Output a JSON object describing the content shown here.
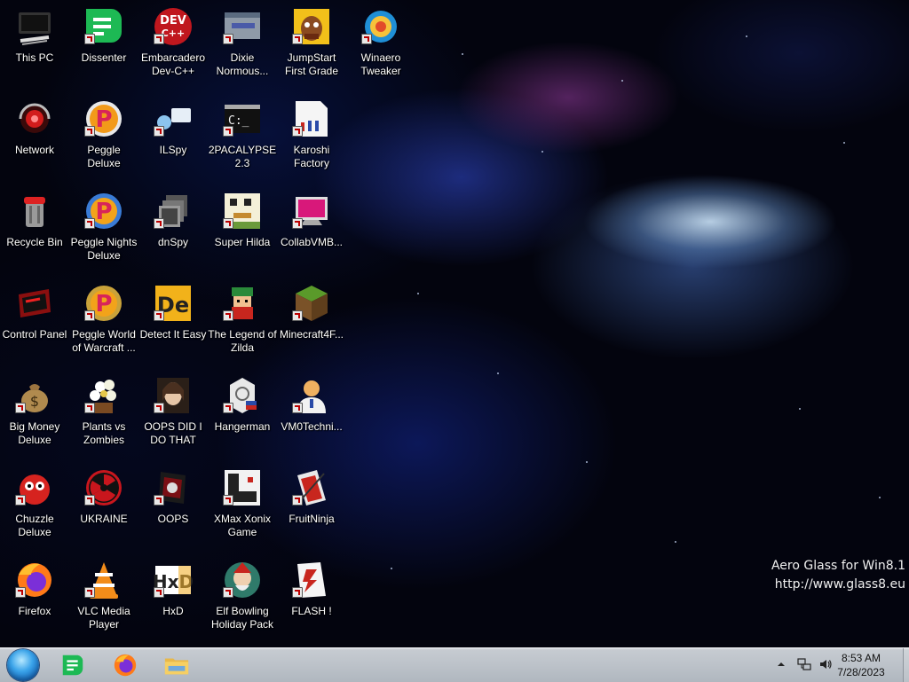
{
  "desktop": {
    "watermark": {
      "line1": "Aero Glass for Win8.1",
      "line2": "http://www.glass8.eu"
    },
    "icons": [
      {
        "label": "This PC",
        "icon": "computer-icon"
      },
      {
        "label": "Network",
        "icon": "network-icon"
      },
      {
        "label": "Recycle Bin",
        "icon": "recycle-bin-icon"
      },
      {
        "label": "Control Panel",
        "icon": "control-panel-icon"
      },
      {
        "label": "Big Money Deluxe",
        "icon": "money-bag-icon"
      },
      {
        "label": "Chuzzle Deluxe",
        "icon": "chuzzle-icon"
      },
      {
        "label": "Firefox",
        "icon": "firefox-icon"
      },
      {
        "label": "Dissenter",
        "icon": "dissenter-icon"
      },
      {
        "label": "Peggle Deluxe",
        "icon": "peggle-icon"
      },
      {
        "label": "Peggle Nights Deluxe",
        "icon": "peggle-nights-icon"
      },
      {
        "label": "Peggle World of Warcraft ...",
        "icon": "peggle-wow-icon"
      },
      {
        "label": "Plants vs Zombies",
        "icon": "plants-vs-zombies-icon"
      },
      {
        "label": "UKRAINE",
        "icon": "radiation-icon"
      },
      {
        "label": "VLC Media Player",
        "icon": "vlc-icon"
      },
      {
        "label": "Embarcadero Dev-C++",
        "icon": "devcpp-icon"
      },
      {
        "label": "ILSpy",
        "icon": "ilspy-icon"
      },
      {
        "label": "dnSpy",
        "icon": "dnspy-icon"
      },
      {
        "label": "Detect It Easy",
        "icon": "detect-it-easy-icon"
      },
      {
        "label": "OOPS DID I DO THAT",
        "icon": "portrait-icon"
      },
      {
        "label": "OOPS",
        "icon": "oops-icon"
      },
      {
        "label": "HxD",
        "icon": "hxd-icon"
      },
      {
        "label": "Dixie Normous...",
        "icon": "window-app-icon"
      },
      {
        "label": "2PACALYPSE 2.3",
        "icon": "console-icon"
      },
      {
        "label": "Super Hilda",
        "icon": "pixel-game-icon"
      },
      {
        "label": "The Legend of Zilda",
        "icon": "zilda-icon"
      },
      {
        "label": "Hangerman",
        "icon": "hangerman-icon"
      },
      {
        "label": "XMax Xonix Game",
        "icon": "xonix-icon"
      },
      {
        "label": "Elf Bowling Holiday Pack",
        "icon": "elf-bowling-icon"
      },
      {
        "label": "JumpStart First Grade",
        "icon": "jumpstart-icon"
      },
      {
        "label": "Karoshi Factory",
        "icon": "karoshi-icon"
      },
      {
        "label": "CollabVMB...",
        "icon": "collabvm-icon"
      },
      {
        "label": "Minecraft4F...",
        "icon": "minecraft-icon"
      },
      {
        "label": "VM0Techni...",
        "icon": "technician-icon"
      },
      {
        "label": "FruitNinja",
        "icon": "fruitninja-icon"
      },
      {
        "label": "FLASH !",
        "icon": "flash-icon"
      },
      {
        "label": "Winaero Tweaker",
        "icon": "winaero-icon"
      }
    ]
  },
  "taskbar": {
    "pinned": [
      {
        "name": "Dissenter",
        "icon": "dissenter-icon"
      },
      {
        "name": "Firefox",
        "icon": "firefox-icon"
      },
      {
        "name": "File Explorer",
        "icon": "folder-icon"
      }
    ],
    "tray": {
      "icons": [
        "chevron-up-icon",
        "network-icon",
        "volume-icon"
      ],
      "time": "8:53 AM",
      "date": "7/28/2023"
    }
  },
  "colors": {
    "dissenter": "#1db954",
    "taskbar": "#c3c9cf",
    "start": "#2f8fdc"
  }
}
